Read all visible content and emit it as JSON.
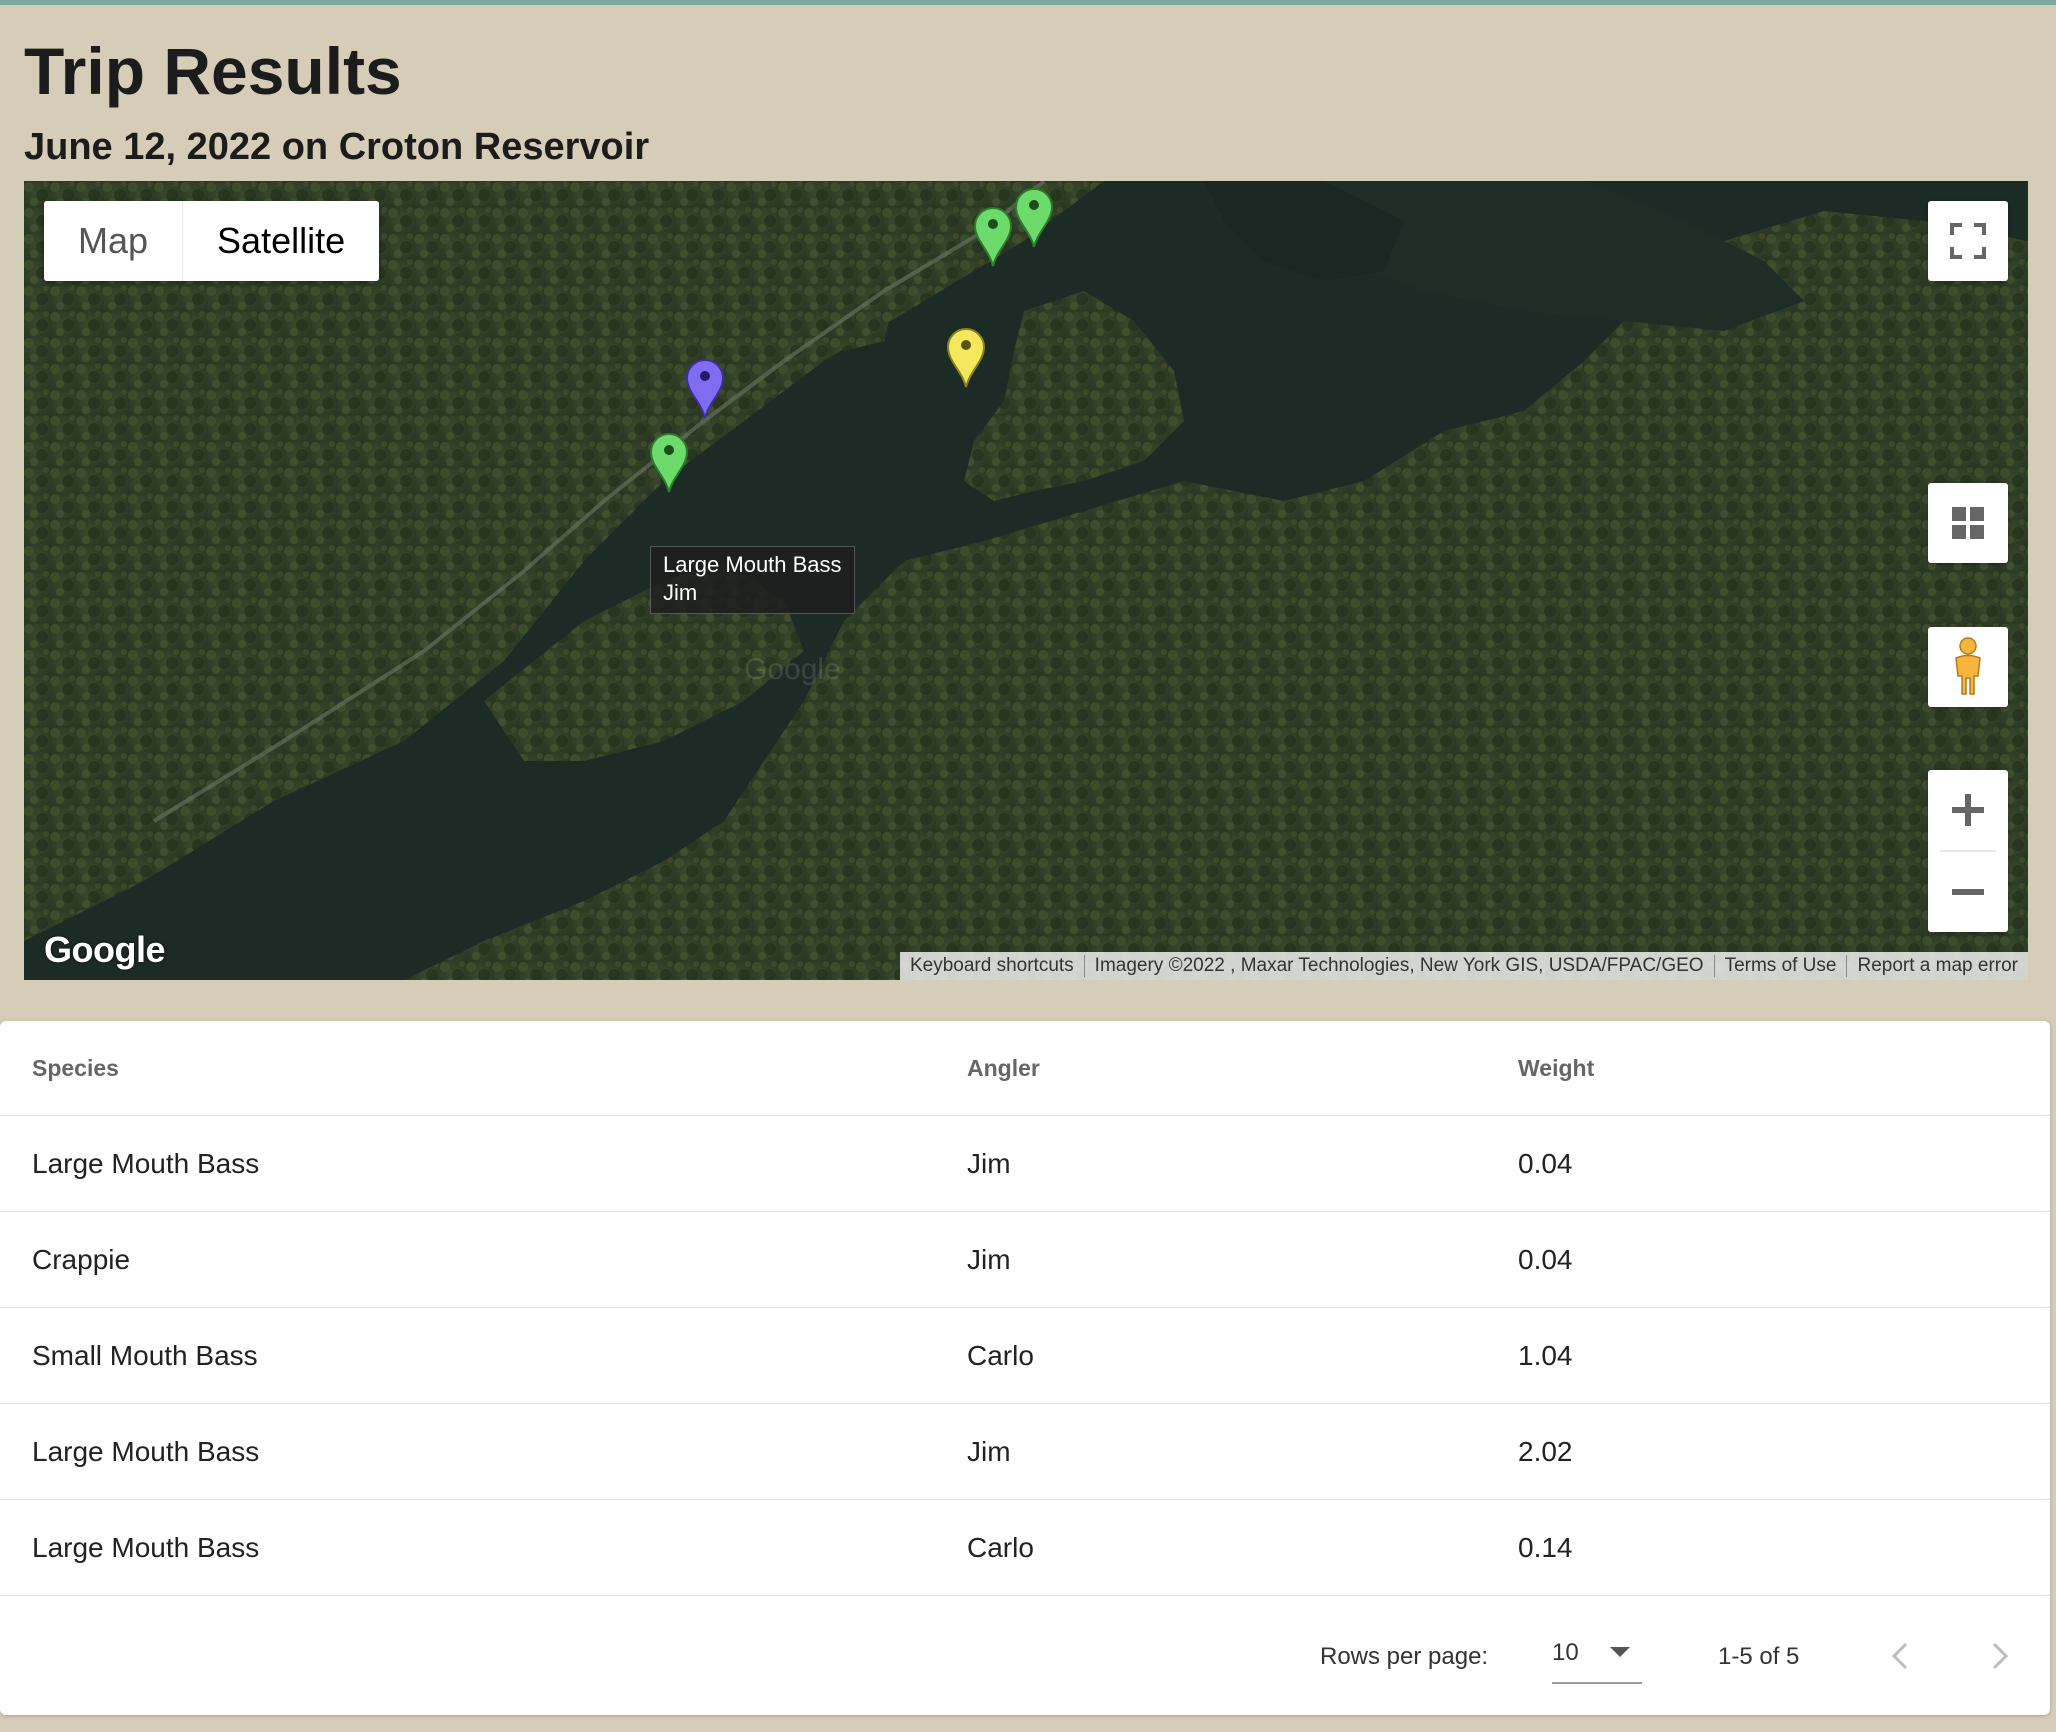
{
  "header": {
    "title": "Trip Results",
    "subtitle": "June 12, 2022 on Croton Reservoir"
  },
  "map": {
    "type_control": {
      "map_label": "Map",
      "satellite_label": "Satellite",
      "active": "Satellite"
    },
    "controls": {
      "fullscreen_icon": "fullscreen-icon",
      "layers_icon": "grid-icon",
      "streetview_icon": "pegman-icon",
      "zoom_in_icon": "plus-icon",
      "zoom_out_icon": "minus-icon"
    },
    "markers": [
      {
        "color": "#6cdb6c",
        "label": "green marker"
      },
      {
        "color": "#6cdb6c",
        "label": "green marker"
      },
      {
        "color": "#f3e85c",
        "label": "yellow marker"
      },
      {
        "color": "#7f6cf0",
        "label": "purple marker"
      },
      {
        "color": "#6cdb6c",
        "label": "green marker"
      }
    ],
    "tooltip": {
      "species": "Large Mouth Bass",
      "angler": "Jim"
    },
    "logo": "Google",
    "attribution": {
      "keyboard": "Keyboard shortcuts",
      "imagery": "Imagery ©2022 , Maxar Technologies, New York GIS, USDA/FPAC/GEO",
      "terms": "Terms of Use",
      "report": "Report a map error"
    }
  },
  "table": {
    "columns": {
      "species": "Species",
      "angler": "Angler",
      "weight": "Weight"
    },
    "rows": [
      {
        "species": "Large Mouth Bass",
        "angler": "Jim",
        "weight": "0.04"
      },
      {
        "species": "Crappie",
        "angler": "Jim",
        "weight": "0.04"
      },
      {
        "species": "Small Mouth Bass",
        "angler": "Carlo",
        "weight": "1.04"
      },
      {
        "species": "Large Mouth Bass",
        "angler": "Jim",
        "weight": "2.02"
      },
      {
        "species": "Large Mouth Bass",
        "angler": "Carlo",
        "weight": "0.14"
      }
    ],
    "pagination": {
      "rows_per_page_label": "Rows per page:",
      "rows_per_page_value": "10",
      "range": "1-5 of 5",
      "prev_icon": "chevron-left-icon",
      "next_icon": "chevron-right-icon"
    }
  },
  "colors": {
    "page_bg": "#d6cdb8",
    "top_strip": "#7ba89c",
    "water": "#1c2a24",
    "forest": "#2e3d26"
  }
}
